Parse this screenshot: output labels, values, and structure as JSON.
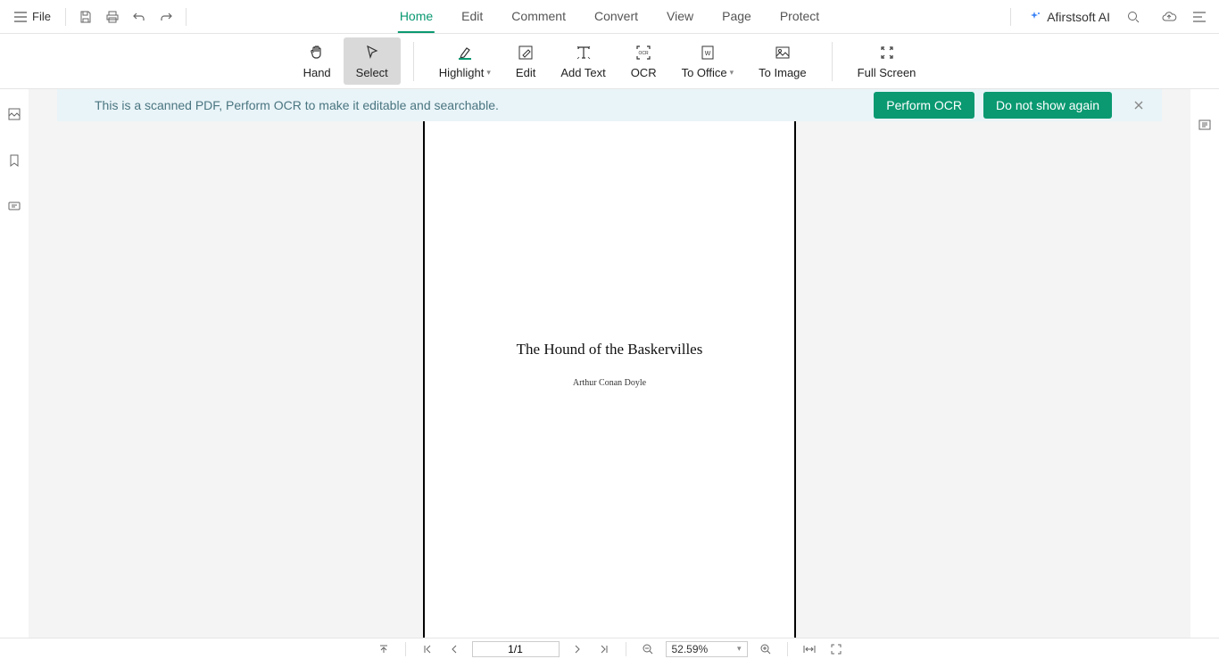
{
  "menubar": {
    "file_label": "File",
    "tabs": [
      {
        "label": "Home",
        "active": true
      },
      {
        "label": "Edit",
        "active": false
      },
      {
        "label": "Comment",
        "active": false
      },
      {
        "label": "Convert",
        "active": false
      },
      {
        "label": "View",
        "active": false
      },
      {
        "label": "Page",
        "active": false
      },
      {
        "label": "Protect",
        "active": false
      }
    ],
    "ai_brand": "Afirstsoft AI"
  },
  "ribbon": {
    "tools": [
      {
        "label": "Hand",
        "icon": "hand",
        "selected": false
      },
      {
        "label": "Select",
        "icon": "cursor",
        "selected": true
      },
      {
        "label": "Highlight",
        "icon": "highlight",
        "dropdown": true
      },
      {
        "label": "Edit",
        "icon": "edit"
      },
      {
        "label": "Add Text",
        "icon": "addtext"
      },
      {
        "label": "OCR",
        "icon": "ocr"
      },
      {
        "label": "To Office",
        "icon": "tooffice",
        "dropdown": true
      },
      {
        "label": "To Image",
        "icon": "toimage"
      },
      {
        "label": "Full Screen",
        "icon": "fullscreen"
      }
    ]
  },
  "notification": {
    "message": "This is a scanned PDF, Perform OCR to make it editable and searchable.",
    "btn_perform": "Perform OCR",
    "btn_dismiss": "Do not show again"
  },
  "document": {
    "title": "The Hound of the Baskervilles",
    "author": "Arthur Conan Doyle"
  },
  "statusbar": {
    "page_display": "1/1",
    "zoom_display": "52.59%"
  },
  "colors": {
    "accent": "#0a9971",
    "banner_bg": "#e9f4f8"
  }
}
